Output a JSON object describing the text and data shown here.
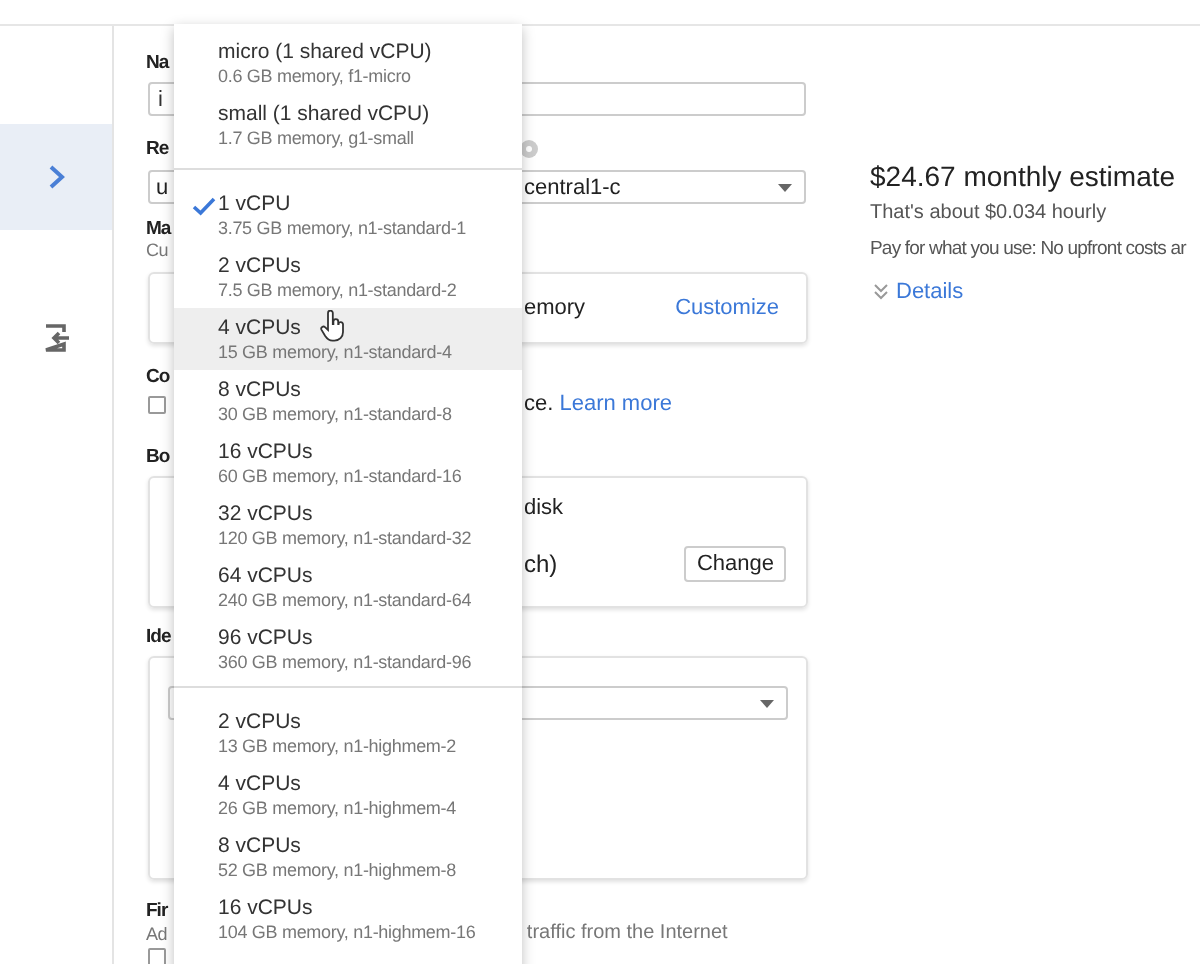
{
  "sidebar": {
    "items": [
      {
        "selected": true
      },
      {
        "selected": false
      }
    ]
  },
  "form": {
    "name": {
      "label": "Na",
      "value": "i"
    },
    "region": {
      "label": "Re",
      "value": "u"
    },
    "zone": {
      "value": "central1-c"
    },
    "machine_type": {
      "label": "Ma",
      "hint": "Cu",
      "summary": "emory",
      "customize": "Customize"
    },
    "container": {
      "label": "Co",
      "checked": false,
      "text": "ce.",
      "link": "Learn more"
    },
    "boot_disk": {
      "label": "Bo",
      "title": "disk",
      "image": "ch)",
      "button": "Change"
    },
    "identity": {
      "label": "Ide"
    },
    "firewall": {
      "label": "Fir",
      "hint": "Ad",
      "option": "traffic from the Internet",
      "checked": false
    }
  },
  "estimate": {
    "price": "$24.67 monthly estimate",
    "hourly": "That's about $0.034 hourly",
    "note": "Pay for what you use: No upfront costs ar",
    "details": "Details"
  },
  "menu": {
    "groups": [
      {
        "items": [
          {
            "title": "micro (1 shared vCPU)",
            "detail": "0.6 GB memory, f1-micro",
            "selected": false,
            "hovered": false
          },
          {
            "title": "small (1 shared vCPU)",
            "detail": "1.7 GB memory, g1-small",
            "selected": false,
            "hovered": false
          }
        ]
      },
      {
        "items": [
          {
            "title": "1 vCPU",
            "detail": "3.75 GB memory, n1-standard-1",
            "selected": true,
            "hovered": false
          },
          {
            "title": "2 vCPUs",
            "detail": "7.5 GB memory, n1-standard-2",
            "selected": false,
            "hovered": false
          },
          {
            "title": "4 vCPUs",
            "detail": "15 GB memory, n1-standard-4",
            "selected": false,
            "hovered": true
          },
          {
            "title": "8 vCPUs",
            "detail": "30 GB memory, n1-standard-8",
            "selected": false,
            "hovered": false
          },
          {
            "title": "16 vCPUs",
            "detail": "60 GB memory, n1-standard-16",
            "selected": false,
            "hovered": false
          },
          {
            "title": "32 vCPUs",
            "detail": "120 GB memory, n1-standard-32",
            "selected": false,
            "hovered": false
          },
          {
            "title": "64 vCPUs",
            "detail": "240 GB memory, n1-standard-64",
            "selected": false,
            "hovered": false
          },
          {
            "title": "96 vCPUs",
            "detail": "360 GB memory, n1-standard-96",
            "selected": false,
            "hovered": false
          }
        ]
      },
      {
        "items": [
          {
            "title": "2 vCPUs",
            "detail": "13 GB memory, n1-highmem-2",
            "selected": false,
            "hovered": false
          },
          {
            "title": "4 vCPUs",
            "detail": "26 GB memory, n1-highmem-4",
            "selected": false,
            "hovered": false
          },
          {
            "title": "8 vCPUs",
            "detail": "52 GB memory, n1-highmem-8",
            "selected": false,
            "hovered": false
          },
          {
            "title": "16 vCPUs",
            "detail": "104 GB memory, n1-highmem-16",
            "selected": false,
            "hovered": false
          }
        ]
      }
    ]
  }
}
